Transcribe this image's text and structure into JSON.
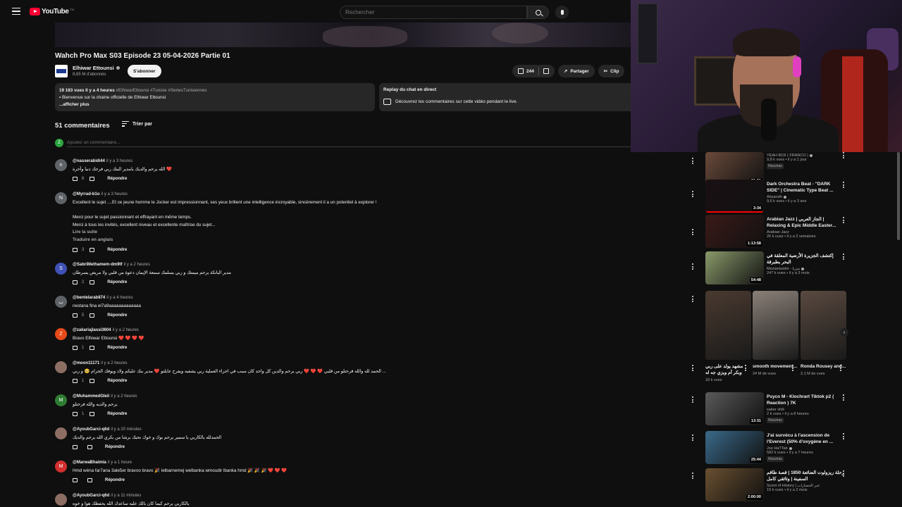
{
  "header": {
    "logo_text": "YouTube",
    "logo_tm": "TN",
    "search_placeholder": "Rechercher",
    "icons": [
      "menu-icon",
      "search-icon",
      "mic-icon"
    ]
  },
  "video": {
    "title": "Wahch Pro Max S03 Episode 23 05-04-2026 Partie 01",
    "channel_name": "Elhiwar Ettounsi",
    "subscribers": "8,65 M d'abonnés",
    "subscribe_label": "S'abonner",
    "likes": "244",
    "share_label": "Partager",
    "clip_label": "Clip"
  },
  "description": {
    "stats": "19 183 vues  Il y a 4 heures",
    "tags": "#ElhiwarEttounsi #Tunisie #SeriesTunisiennes",
    "line1": "Bienvenue sur la chaine officielle de Elhiwar Ettounsi",
    "more": "...afficher plus"
  },
  "chat_replay": {
    "title": "Replay du chat en direct",
    "text": "Découvrez les commentaires sur cette vidéo pendant le live."
  },
  "comments_section": {
    "count_label": "51 commentaires",
    "sort_label": "Trier par",
    "add_placeholder": "Ajoutez un commentaire...",
    "user_initial": "Z"
  },
  "comments": [
    {
      "handle": "@nasserabidi44",
      "time": "il y a 3 heures",
      "initial": "n",
      "color": "#5f6368",
      "lines": [
        "الله يرحم والديك يامدير البنك ربي فرحك دنيا وآخرة ❤️"
      ],
      "likes": "6",
      "reply": "Répondre"
    },
    {
      "handle": "@Myrrad-b1o",
      "time": "il y a 3 heures",
      "initial": "N",
      "color": "#5f6368",
      "lines": [
        "Excellent le sujet ....Et ce jeune homme le Jocker est impressionnant, ses yeux brillent une intelligence incroyable, sincèrement il a un potentiel à explorer !",
        "",
        "Merci pour le sujet passionnant et effrayant en même temps.",
        "Merci à tous les invités, excellent niveau et excellente maîtrise du sujet..."
      ],
      "more": "Lire la suite",
      "translate": "Traduire en anglais",
      "likes": "3",
      "reply": "Répondre"
    },
    {
      "handle": "@SabriMethamem-dm9tf",
      "time": "il y a 2 heures",
      "initial": "S",
      "color": "#3f51b5",
      "lines": [
        "مدير البانكة يرحم ميمتك و ربي يسلمك سمعة الإيمان دعوة من قلبي ولا مريض يسرطان"
      ],
      "likes": "2",
      "reply": "Répondre"
    },
    {
      "handle": "@bentelarab874",
      "time": "il y a 4 heures",
      "initial": "ب",
      "color": "#5f6368",
      "lines": [
        "nestana fina el7a9aaaaaaaaaaaaa"
      ],
      "likes": "5",
      "reply": "Répondre"
    },
    {
      "handle": "@zakariajlassi3604",
      "time": "il y a 2 heures",
      "initial": "Z",
      "color": "#e64a19",
      "lines": [
        "Bravo Elhiwar Ettounsi ❤️ ❤️ ❤️ ❤️"
      ],
      "likes": "1",
      "reply": "Répondre"
    },
    {
      "handle": "@moon11171",
      "time": "il y a 2 heures",
      "initial": "",
      "color": "#8d6e63",
      "lines": [
        "الحمد لله والله فرحتلو من قلبي ❤️ ❤️ ❤️ ربي يرحم والدين كل واحد كان سبب في اجراء العملية ربي يشفيه ويفرح عايلتو ❤️ مدير بنك عليكم ولاد ويوفك الحرام 🥺 و ربي ..."
      ],
      "likes": "1",
      "reply": "Répondre"
    },
    {
      "handle": "@MuhammedGleii",
      "time": "il y a 2 heures",
      "initial": "M",
      "color": "#2e7d32",
      "lines": [
        "يرحم والديه والله فرحتلو"
      ],
      "likes": "1",
      "reply": "Répondre"
    },
    {
      "handle": "@AyoubGarci-q6d",
      "time": "il y a 20 minutes",
      "initial": "",
      "color": "#8d6e63",
      "lines": [
        "الحمدلله يالكاربي يا سمير يرحم بوك و خوك نحبك برشا من بكري الله يرحم والديك"
      ],
      "likes": "",
      "reply": "Répondre"
    },
    {
      "handle": "@MarwaBhaimia",
      "time": "il y a 1 heure",
      "initial": "M",
      "color": "#d32f2f",
      "lines": [
        "Hmd wéna far7ana 3ale5er bravoo bravo 🎉 lelbarnemej welbanka wmoudir lbanka hmd 🎉 🎉 🎉 ❤️ ❤️ ❤️"
      ],
      "likes": "",
      "reply": "Répondre"
    },
    {
      "handle": "@AyoubGarci-q6d",
      "time": "il y a 11 minutes",
      "initial": "",
      "color": "#8d6e63",
      "lines": [
        "يالكاربي يرحم كيما كان بالك عليه ساعدك الله يحفظك هوا و خوه"
      ],
      "likes": "",
      "reply": ""
    }
  ],
  "sidebar": [
    {
      "title": "",
      "channel": "YEAH BOII ( FRANCO )",
      "meta": "9,8 k vues • il y a 1 jour",
      "badge": "Nouveau",
      "duration": "21:51",
      "thumb": "#6a4a3a",
      "verified": true
    },
    {
      "title": "Dark Orchestra Beat - \"DARK SIDE\" | Cinematic Type Beat ...",
      "channel": "Absaroth",
      "meta": "9,6 k vues • il y a 3 ans",
      "badge": "",
      "duration": "3:34",
      "thumb": "#1a1014",
      "verified": true
    },
    {
      "title": "Arabian Jazz | الجاز العربي | Relaxing & Epic Middle Easter...",
      "channel": "Arabian Jazz",
      "meta": "26 k vues • il y a 2 semaines",
      "badge": "",
      "duration": "1:13:58",
      "thumb": "#3a1a18",
      "verified": false
    },
    {
      "title": "إكتشف الجزيرة الأرضية المعلقة في البحر بطبرقة",
      "channel": "Mezianissimi - ميزيا",
      "meta": "247 k vues • il y a 3 mois",
      "badge": "",
      "duration": "54:48",
      "thumb": "#8a9a6a",
      "verified": true
    },
    {
      "title": "Psyco M - Klochrart Tiktok p2 ( Reaction ) 7K",
      "channel": "saber shili",
      "meta": "2 k vues • il y a 8 heures",
      "badge": "Nouveau",
      "duration": "13:31",
      "thumb": "#5a5a5a",
      "verified": false
    },
    {
      "title": "J'ai survécu à l'ascension de l'Everest (50% d'oxygène en ...",
      "channel": "Joe HaTTab",
      "meta": "582 k vues • il y a 7 heures",
      "badge": "Nouveau",
      "duration": "25:44",
      "thumb": "#3a6a8a",
      "verified": true
    },
    {
      "title": "رحلة ريزولوت الضائعة 1850 | قصة طاقم السفينة | وثائقي كامل",
      "channel": "Scent of History | عبر الحضارات",
      "meta": "19 k vues • il y a 2 mois",
      "badge": "",
      "duration": "2:00:00",
      "thumb": "#6a5030",
      "verified": false
    }
  ],
  "shorts": [
    {
      "title": "مشهد يولد على ربي وبكر أم ويزي جه له",
      "views": "18 k vues",
      "thumb": "#4a3a30"
    },
    {
      "title": "smooth movement...",
      "views": "24 M de vues",
      "thumb": "#8a8078"
    },
    {
      "title": "Ronda Rousey and...",
      "views": "2,1 M de vues",
      "thumb": "#5a4a40"
    }
  ]
}
